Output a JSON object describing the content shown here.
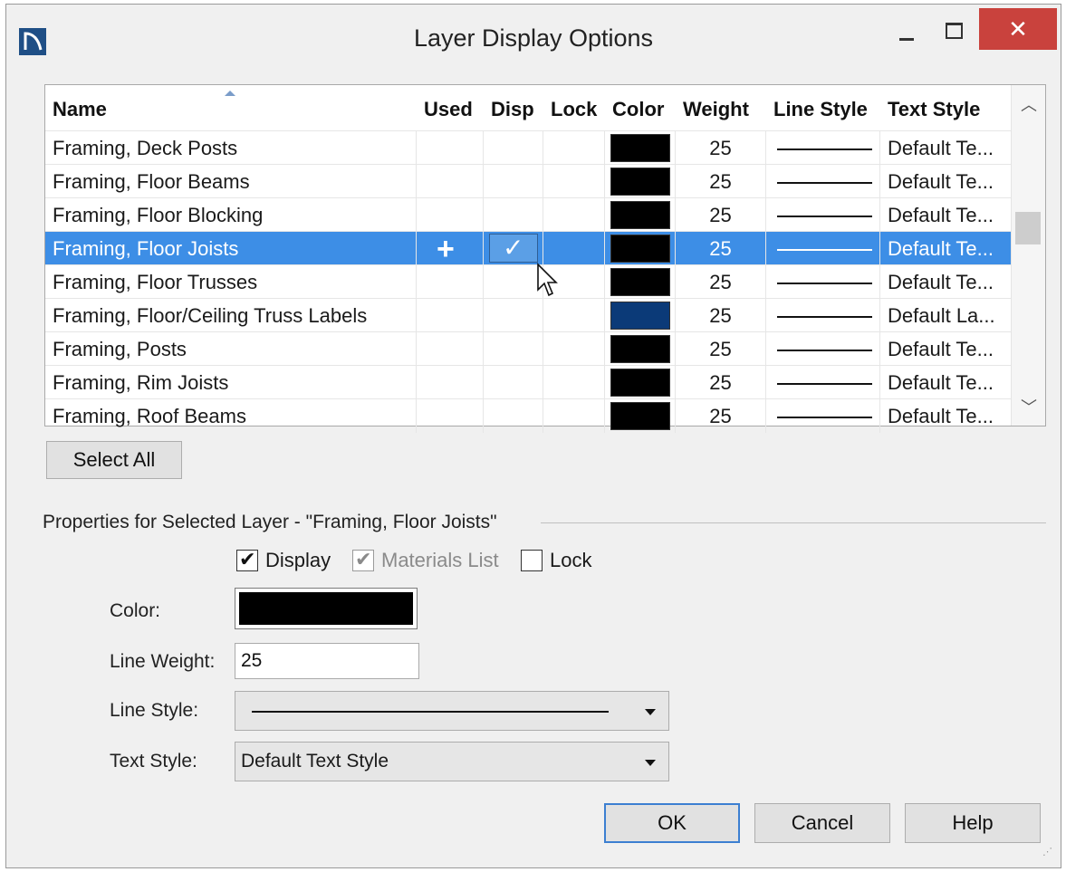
{
  "window": {
    "title": "Layer Display Options",
    "close_glyph": "✕"
  },
  "table": {
    "columns": [
      "Name",
      "Used",
      "Disp",
      "Lock",
      "Color",
      "Weight",
      "Line Style",
      "Text Style"
    ],
    "rows": [
      {
        "name": "Framing, Deck Posts",
        "weight": "25",
        "text_style": "Default Te...",
        "color": "#000000"
      },
      {
        "name": "Framing, Floor Beams",
        "weight": "25",
        "text_style": "Default Te...",
        "color": "#000000"
      },
      {
        "name": "Framing, Floor Blocking",
        "weight": "25",
        "text_style": "Default Te...",
        "color": "#000000"
      },
      {
        "name": "Framing, Floor Joists",
        "weight": "25",
        "text_style": "Default Te...",
        "color": "#000000",
        "selected": true,
        "used": "plus-icon",
        "disp": "check-icon"
      },
      {
        "name": "Framing, Floor Trusses",
        "weight": "25",
        "text_style": "Default Te...",
        "color": "#000000"
      },
      {
        "name": "Framing, Floor/Ceiling Truss Labels",
        "weight": "25",
        "text_style": "Default La...",
        "color": "#0b3a78"
      },
      {
        "name": "Framing, Posts",
        "weight": "25",
        "text_style": "Default Te...",
        "color": "#000000"
      },
      {
        "name": "Framing, Rim Joists",
        "weight": "25",
        "text_style": "Default Te...",
        "color": "#000000"
      },
      {
        "name": "Framing, Roof Beams",
        "weight": "25",
        "text_style": "Default Te...",
        "color": "#000000"
      }
    ]
  },
  "select_all_label": "Select All",
  "properties": {
    "group_title": "Properties for Selected Layer - \"Framing, Floor Joists\"",
    "display_label": "Display",
    "materials_label": "Materials List",
    "lock_label": "Lock",
    "color_label": "Color:",
    "line_weight_label": "Line Weight:",
    "line_weight_value": "25",
    "line_style_label": "Line Style:",
    "text_style_label": "Text Style:",
    "text_style_value": "Default Text Style"
  },
  "buttons": {
    "ok": "OK",
    "cancel": "Cancel",
    "help": "Help"
  },
  "colors": {
    "selection": "#3d8ee6",
    "close_button": "#c9423d",
    "layer_blue": "#0b3a78"
  }
}
